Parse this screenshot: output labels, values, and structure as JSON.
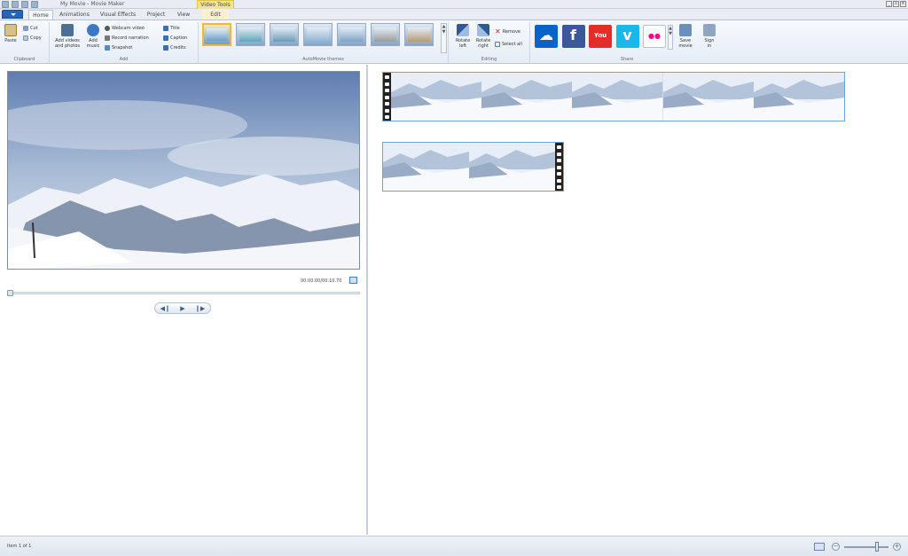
{
  "window": {
    "title": "My Movie - Movie Maker",
    "contextual_tab_group": "Video Tools"
  },
  "tabs": [
    "Home",
    "Animations",
    "Visual Effects",
    "Project",
    "View",
    "Edit"
  ],
  "active_tab": "Home",
  "ribbon": {
    "clipboard": {
      "label": "Clipboard",
      "paste": "Paste",
      "cut": "Cut",
      "copy": "Copy"
    },
    "add": {
      "label": "Add",
      "add_videos_line1": "Add videos",
      "add_videos_line2": "and photos",
      "add_music_line1": "Add",
      "add_music_line2": "music",
      "webcam_video": "Webcam video",
      "record_narration": "Record narration",
      "snapshot": "Snapshot",
      "title": "Title",
      "caption": "Caption",
      "credits": "Credits"
    },
    "automovie": {
      "label": "AutoMovie themes",
      "selected_index": 0,
      "count": 7
    },
    "editing": {
      "label": "Editing",
      "rotate_left_line1": "Rotate",
      "rotate_left_line2": "left",
      "rotate_right_line1": "Rotate",
      "rotate_right_line2": "right",
      "remove": "Remove",
      "select_all": "Select all"
    },
    "share": {
      "label": "Share",
      "services": [
        {
          "name": "onedrive-icon",
          "color": "#0a64c8"
        },
        {
          "name": "facebook-icon",
          "color": "#3b5998"
        },
        {
          "name": "youtube-icon",
          "color": "#e52d27"
        },
        {
          "name": "vimeo-icon",
          "color": "#1ab7ea"
        },
        {
          "name": "flickr-icon",
          "color": "#ffffff"
        }
      ],
      "save_movie_line1": "Save",
      "save_movie_line2": "movie",
      "sign_in_line1": "Sign",
      "sign_in_line2": "in"
    }
  },
  "preview": {
    "timecode": "00:00.00/00:10.70"
  },
  "storyboard": {
    "clips": [
      {
        "frames": 5
      },
      {
        "frames": 2
      }
    ]
  },
  "status": {
    "text": "Item 1 of 1"
  },
  "colors": {
    "accent": "#2a62b6",
    "video_tools_tab": "#f3e58a",
    "selection_border": "#6ea3d3"
  }
}
